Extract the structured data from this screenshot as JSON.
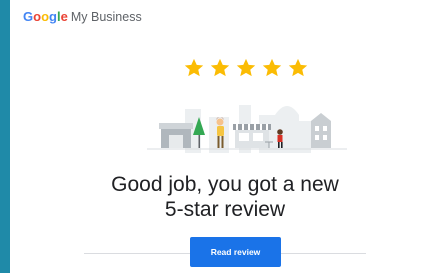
{
  "brand": {
    "google_letters": [
      {
        "ch": "G",
        "color": "#4285F4"
      },
      {
        "ch": "o",
        "color": "#EA4335"
      },
      {
        "ch": "o",
        "color": "#FBBC05"
      },
      {
        "ch": "g",
        "color": "#4285F4"
      },
      {
        "ch": "l",
        "color": "#34A853"
      },
      {
        "ch": "e",
        "color": "#EA4335"
      }
    ],
    "suffix": "My Business"
  },
  "rating": {
    "stars": 5,
    "max": 5,
    "star_color": "#FBBC04"
  },
  "illustration": {
    "icon": "town-scene-illustration"
  },
  "headline": {
    "line1": "Good job, you got a new",
    "line2": "5-star review"
  },
  "cta": {
    "label": "Read review"
  },
  "colors": {
    "accent": "#1a73e8",
    "background": "#1f8aa8"
  }
}
